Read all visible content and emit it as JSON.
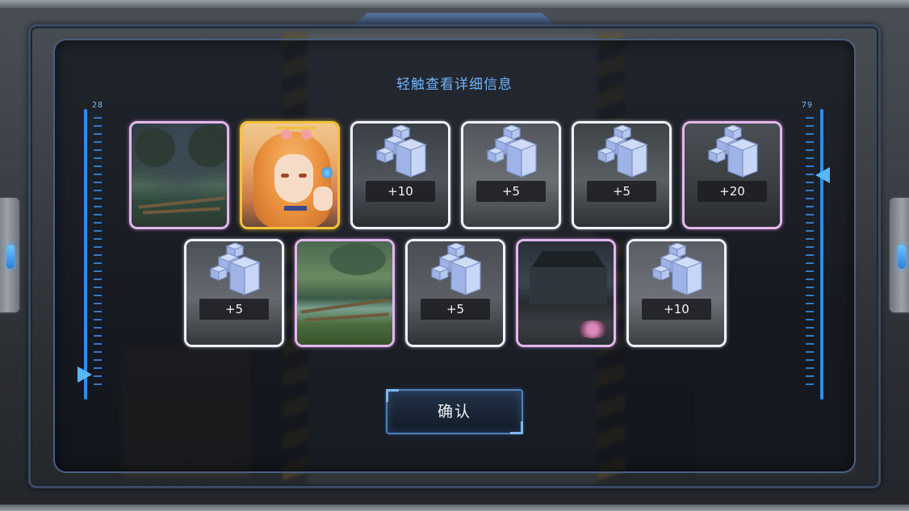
{
  "header": {
    "title": "轻触查看详细信息"
  },
  "rulers": {
    "left_value": "28",
    "right_value": "79"
  },
  "rewards": {
    "row1": [
      {
        "kind": "scene",
        "frame": "purple",
        "art": "lake"
      },
      {
        "kind": "character",
        "frame": "gold",
        "art": "portrait"
      },
      {
        "kind": "cube",
        "frame": "white",
        "amount": "+10"
      },
      {
        "kind": "cube",
        "frame": "white",
        "amount": "+5"
      },
      {
        "kind": "cube",
        "frame": "white",
        "amount": "+5"
      },
      {
        "kind": "cube",
        "frame": "purple",
        "amount": "+20"
      }
    ],
    "row2": [
      {
        "kind": "cube",
        "frame": "white",
        "amount": "+5"
      },
      {
        "kind": "scene",
        "frame": "purple",
        "art": "lake-green"
      },
      {
        "kind": "cube",
        "frame": "white",
        "amount": "+5"
      },
      {
        "kind": "scene",
        "frame": "purple",
        "art": "house"
      },
      {
        "kind": "cube",
        "frame": "white",
        "amount": "+10"
      }
    ]
  },
  "buttons": {
    "confirm_label": "确认"
  },
  "colors": {
    "accent": "#6fb4ff",
    "frame_purple": "#e2b8ea",
    "frame_gold": "#f2c23a",
    "frame_white": "#eef2f8"
  },
  "icons": {
    "cube": "cube-cluster-icon"
  }
}
